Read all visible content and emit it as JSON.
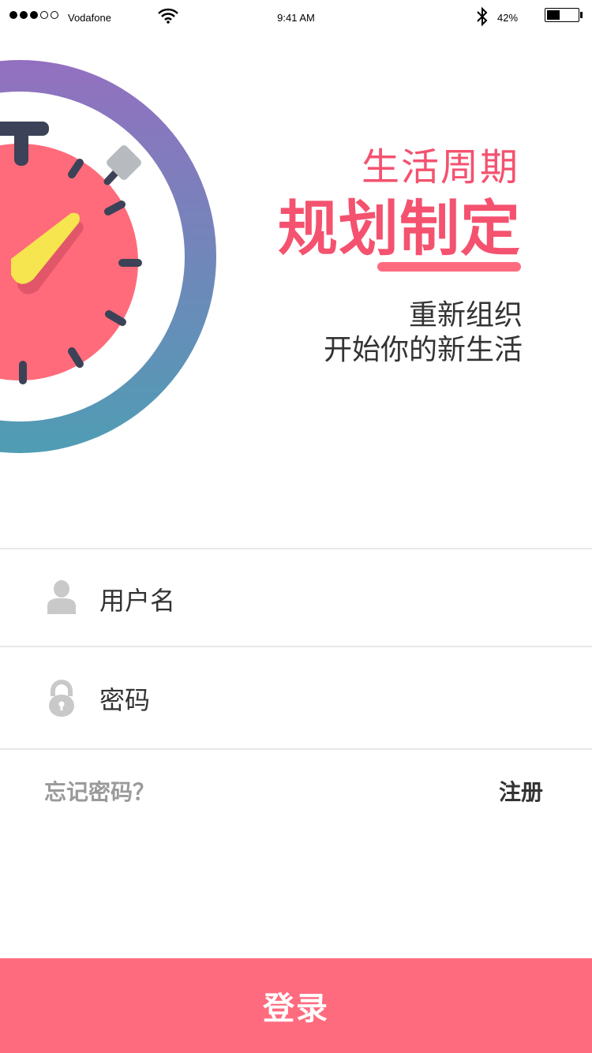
{
  "status_bar": {
    "carrier": "Vodafone",
    "time": "9:41 AM",
    "battery_pct": "42%",
    "battery_level": 0.42,
    "signal_filled": 3,
    "signal_total": 5
  },
  "hero": {
    "title_line1": "生活周期",
    "title_line2": "规划制定",
    "subtitle_line1": "重新组织",
    "subtitle_line2": "开始你的新生活",
    "accent_color": "#f4526f",
    "illustration": "stopwatch-icon"
  },
  "form": {
    "username_placeholder": "用户名",
    "password_placeholder": "密码",
    "username_icon": "user-icon",
    "password_icon": "lock-icon",
    "forgot_password": "忘记密码？",
    "register": "注册"
  },
  "login": {
    "label": "登录",
    "color": "#ff6b7e"
  }
}
